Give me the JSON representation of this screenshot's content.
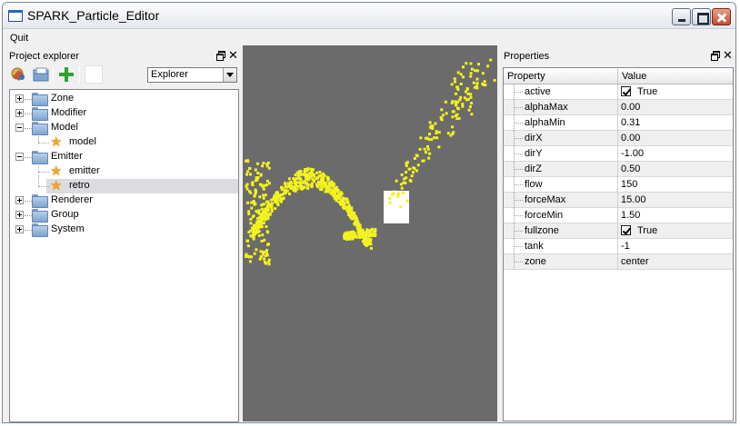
{
  "window": {
    "title": "SPARK_Particle_Editor",
    "controls": [
      "minimize",
      "maximize",
      "close"
    ]
  },
  "menu": {
    "items": [
      "Quit"
    ]
  },
  "explorer": {
    "title": "Project explorer",
    "toolbar": {
      "buttons": [
        "open-project-icon",
        "open-folder-icon",
        "add-icon",
        "blank-icon"
      ],
      "combo_value": "Explorer"
    },
    "tree": [
      {
        "label": "Zone",
        "type": "folder",
        "expanded": false
      },
      {
        "label": "Modifier",
        "type": "folder",
        "expanded": false
      },
      {
        "label": "Model",
        "type": "folder",
        "expanded": true
      },
      {
        "label": "model",
        "type": "star",
        "parent": "Model"
      },
      {
        "label": "Emitter",
        "type": "folder",
        "expanded": true
      },
      {
        "label": "emitter",
        "type": "star",
        "parent": "Emitter"
      },
      {
        "label": "retro",
        "type": "star",
        "parent": "Emitter",
        "selected": true
      },
      {
        "label": "Renderer",
        "type": "folder",
        "expanded": false
      },
      {
        "label": "Group",
        "type": "folder",
        "expanded": false
      },
      {
        "label": "System",
        "type": "folder",
        "expanded": false
      }
    ]
  },
  "viewport": {
    "background": "#6b6b6b",
    "particle_color": "#f2f21e",
    "emitter_color": "#ffffff"
  },
  "properties": {
    "title": "Properties",
    "header": {
      "property": "Property",
      "value": "Value"
    },
    "rows": [
      {
        "name": "active",
        "value": "True",
        "checkbox": true
      },
      {
        "name": "alphaMax",
        "value": "0.00"
      },
      {
        "name": "alphaMin",
        "value": "0.31"
      },
      {
        "name": "dirX",
        "value": "0.00"
      },
      {
        "name": "dirY",
        "value": "-1.00"
      },
      {
        "name": "dirZ",
        "value": "0.50"
      },
      {
        "name": "flow",
        "value": "150"
      },
      {
        "name": "forceMax",
        "value": "15.00"
      },
      {
        "name": "forceMin",
        "value": "1.50"
      },
      {
        "name": "fullzone",
        "value": "True",
        "checkbox": true
      },
      {
        "name": "tank",
        "value": "-1"
      },
      {
        "name": "zone",
        "value": "center"
      }
    ]
  }
}
